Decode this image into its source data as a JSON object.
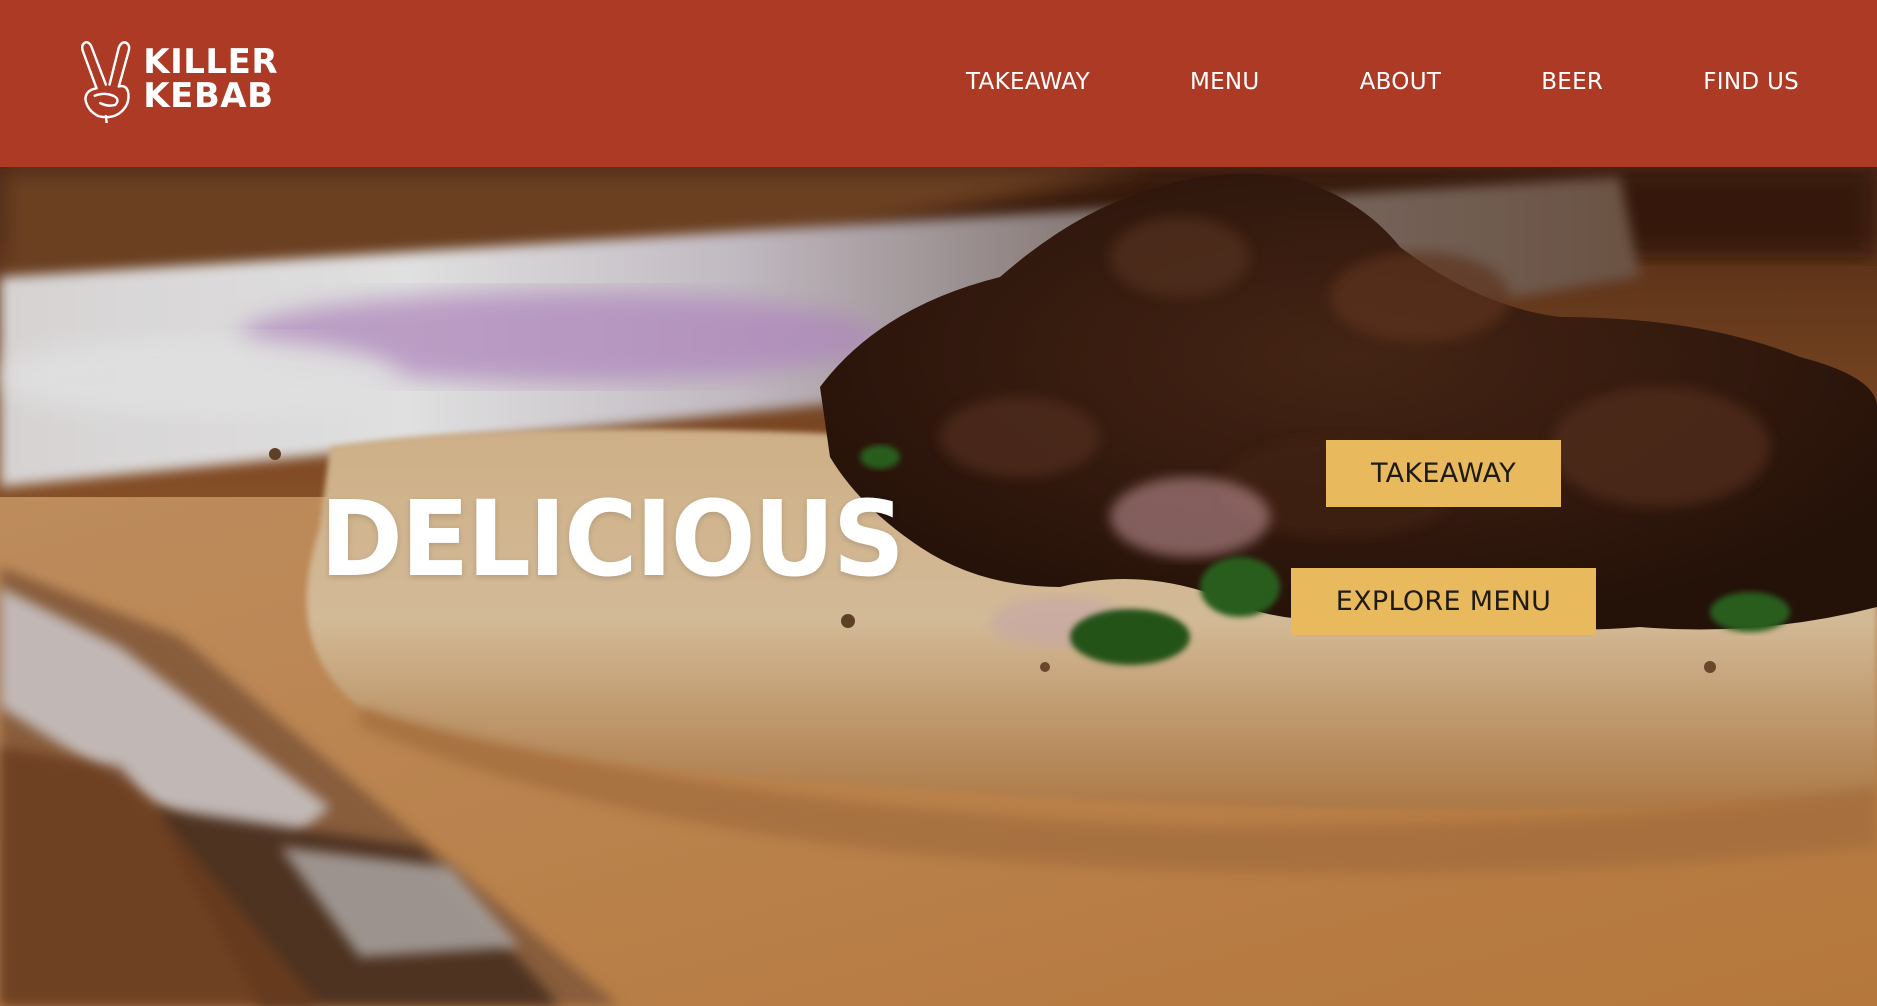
{
  "brand": {
    "name_line1": "KILLER",
    "name_line2": "KEBAB",
    "logo_icon": "peace-hand-icon",
    "header_color": "#ad3a24"
  },
  "nav": {
    "items": [
      {
        "label": "TAKEAWAY"
      },
      {
        "label": "MENU"
      },
      {
        "label": "ABOUT"
      },
      {
        "label": "BEER"
      },
      {
        "label": "FIND US"
      }
    ]
  },
  "hero": {
    "title": "DELICIOUS",
    "cta_takeaway": "TAKEAWAY",
    "cta_menu": "EXPLORE MENU",
    "cta_color": "#e9b95e"
  }
}
